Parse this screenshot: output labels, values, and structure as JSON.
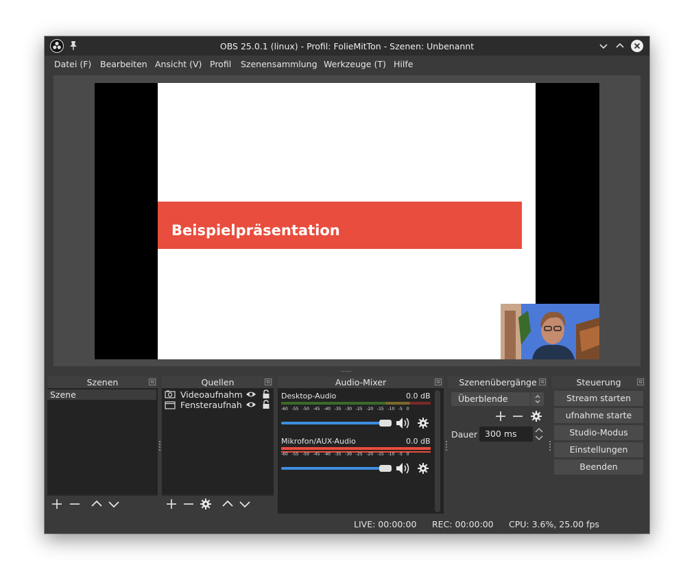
{
  "window": {
    "title": "OBS 25.0.1 (linux) - Profil: FolieMitTon - Szenen: Unbenannt"
  },
  "menu": {
    "items": [
      "Datei (F)",
      "Bearbeiten",
      "Ansicht (V)",
      "Profil",
      "Szenensammlung",
      "Werkzeuge (T)",
      "Hilfe"
    ]
  },
  "preview": {
    "slide_title": "Beispielpräsentation",
    "slide_band_color": "#e84d3d",
    "resize_grip": "......"
  },
  "docks": {
    "scenes": {
      "title": "Szenen",
      "items": [
        "Szene"
      ]
    },
    "sources": {
      "title": "Quellen",
      "items": [
        {
          "label": "Videoaufnahme",
          "icon": "camera-icon"
        },
        {
          "label": "Fensteraufnahme",
          "icon": "window-icon"
        }
      ]
    },
    "mixer": {
      "title": "Audio-Mixer",
      "channels": [
        {
          "name": "Desktop-Audio",
          "level": "0.0 dB",
          "volume": 1.0
        },
        {
          "name": "Mikrofon/AUX-Audio",
          "level": "0.0 dB",
          "volume": 1.0
        }
      ],
      "scale": [
        "-60",
        "-55",
        "-50",
        "-45",
        "-40",
        "-35",
        "-30",
        "-25",
        "-20",
        "-15",
        "-10",
        "-5",
        "0"
      ]
    },
    "transitions": {
      "title": "Szenenübergänge",
      "selected": "Überblende",
      "duration_label": "Dauer",
      "duration_value": "300 ms"
    },
    "controls": {
      "title": "Steuerung",
      "buttons": [
        "Stream starten",
        "ufnahme starte",
        "Studio-Modus",
        "Einstellungen",
        "Beenden"
      ]
    }
  },
  "status": {
    "live": "LIVE: 00:00:00",
    "rec": "REC: 00:00:00",
    "cpu": "CPU: 3.6%, 25.00 fps"
  },
  "colors": {
    "accent": "#3d8fe0",
    "meter_green": "#4caf50",
    "meter_red": "#e84d3d"
  }
}
